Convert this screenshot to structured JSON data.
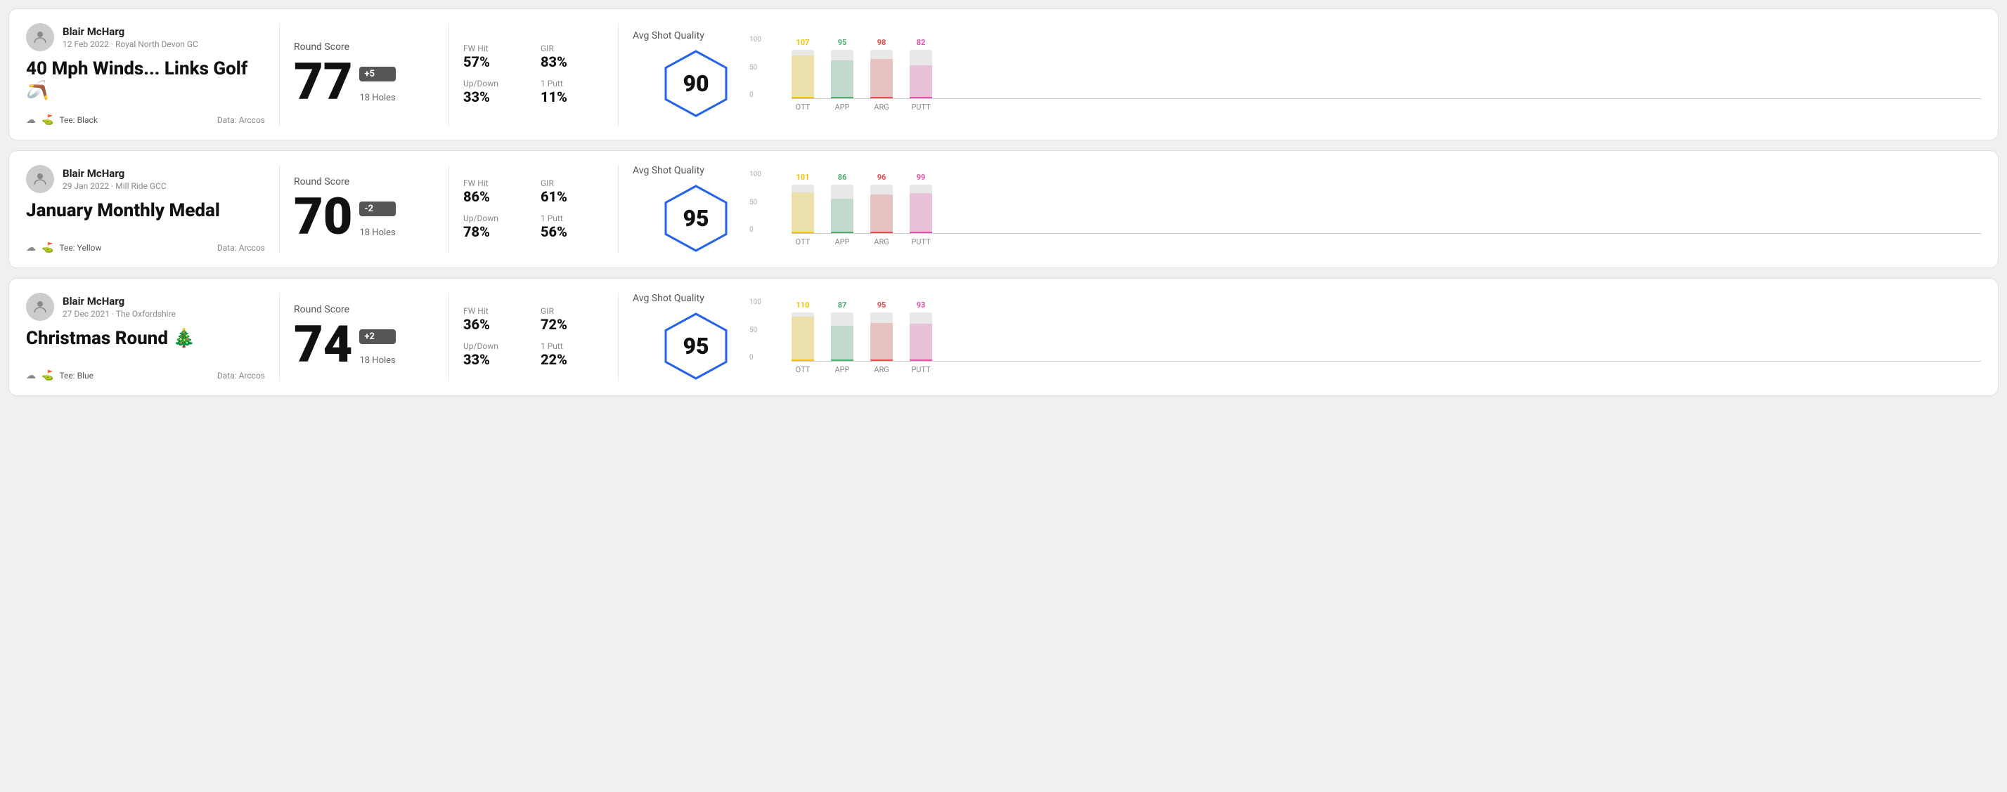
{
  "rounds": [
    {
      "id": "round1",
      "user": {
        "name": "Blair McHarg",
        "date": "12 Feb 2022",
        "venue": "Royal North Devon GC"
      },
      "title": "40 Mph Winds... Links Golf 🪃",
      "tee": "Black",
      "data_source": "Data: Arccos",
      "score": {
        "label": "Round Score",
        "number": "77",
        "badge": "+5",
        "holes": "18 Holes"
      },
      "stats": {
        "fw_hit_label": "FW Hit",
        "fw_hit_value": "57%",
        "gir_label": "GIR",
        "gir_value": "83%",
        "updown_label": "Up/Down",
        "updown_value": "33%",
        "putt1_label": "1 Putt",
        "putt1_value": "11%"
      },
      "quality": {
        "label": "Avg Shot Quality",
        "score": "90"
      },
      "chart": {
        "bars": [
          {
            "name": "OTT",
            "value": 107,
            "color": "#f5c400"
          },
          {
            "name": "APP",
            "value": 95,
            "color": "#4caf72"
          },
          {
            "name": "ARG",
            "value": 98,
            "color": "#e94c4c"
          },
          {
            "name": "PUTT",
            "value": 82,
            "color": "#e94caa"
          }
        ],
        "max": 120,
        "y_labels": [
          "100",
          "50",
          "0"
        ]
      }
    },
    {
      "id": "round2",
      "user": {
        "name": "Blair McHarg",
        "date": "29 Jan 2022",
        "venue": "Mill Ride GCC"
      },
      "title": "January Monthly Medal",
      "tee": "Yellow",
      "data_source": "Data: Arccos",
      "score": {
        "label": "Round Score",
        "number": "70",
        "badge": "-2",
        "holes": "18 Holes"
      },
      "stats": {
        "fw_hit_label": "FW Hit",
        "fw_hit_value": "86%",
        "gir_label": "GIR",
        "gir_value": "61%",
        "updown_label": "Up/Down",
        "updown_value": "78%",
        "putt1_label": "1 Putt",
        "putt1_value": "56%"
      },
      "quality": {
        "label": "Avg Shot Quality",
        "score": "95"
      },
      "chart": {
        "bars": [
          {
            "name": "OTT",
            "value": 101,
            "color": "#f5c400"
          },
          {
            "name": "APP",
            "value": 86,
            "color": "#4caf72"
          },
          {
            "name": "ARG",
            "value": 96,
            "color": "#e94c4c"
          },
          {
            "name": "PUTT",
            "value": 99,
            "color": "#e94caa"
          }
        ],
        "max": 120,
        "y_labels": [
          "100",
          "50",
          "0"
        ]
      }
    },
    {
      "id": "round3",
      "user": {
        "name": "Blair McHarg",
        "date": "27 Dec 2021",
        "venue": "The Oxfordshire"
      },
      "title": "Christmas Round 🎄",
      "tee": "Blue",
      "data_source": "Data: Arccos",
      "score": {
        "label": "Round Score",
        "number": "74",
        "badge": "+2",
        "holes": "18 Holes"
      },
      "stats": {
        "fw_hit_label": "FW Hit",
        "fw_hit_value": "36%",
        "gir_label": "GIR",
        "gir_value": "72%",
        "updown_label": "Up/Down",
        "updown_value": "33%",
        "putt1_label": "1 Putt",
        "putt1_value": "22%"
      },
      "quality": {
        "label": "Avg Shot Quality",
        "score": "95"
      },
      "chart": {
        "bars": [
          {
            "name": "OTT",
            "value": 110,
            "color": "#f5c400"
          },
          {
            "name": "APP",
            "value": 87,
            "color": "#4caf72"
          },
          {
            "name": "ARG",
            "value": 95,
            "color": "#e94c4c"
          },
          {
            "name": "PUTT",
            "value": 93,
            "color": "#e94caa"
          }
        ],
        "max": 120,
        "y_labels": [
          "100",
          "50",
          "0"
        ]
      }
    }
  ]
}
